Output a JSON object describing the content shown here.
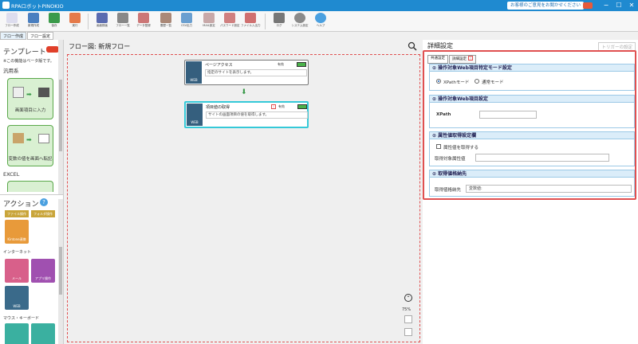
{
  "window": {
    "title": "RPAロボットPINOKIO",
    "inquiry": "お客様のご意見をお聞かせください",
    "min_label": "−",
    "max_label": "☐",
    "close_label": "✕"
  },
  "toolbar": {
    "buttons": [
      {
        "label": "フロー作成"
      },
      {
        "label": "新規作成"
      },
      {
        "label": "保存"
      },
      {
        "label": "実行"
      },
      {
        "label": "画面録画"
      },
      {
        "label": "フロー一覧"
      },
      {
        "label": "データ登録"
      },
      {
        "label": "履歴一覧"
      },
      {
        "label": "CSV出力"
      },
      {
        "label": "MAIL設定"
      },
      {
        "label": "パスワード設定"
      },
      {
        "label": "ファイル入出力"
      },
      {
        "label": "ログ"
      },
      {
        "label": "システム設定"
      },
      {
        "label": "ヘルプ"
      }
    ]
  },
  "subtabs": {
    "flow": "フロー作成",
    "settings": "フロー設定"
  },
  "left": {
    "template_title": "テンプレート",
    "beta_note": "※この機能はベータ版です。",
    "general": "汎用系",
    "cards": [
      {
        "label": "画面項目に入力"
      },
      {
        "label": "変数の値を画面へ転記"
      }
    ],
    "excel": "EXCEL",
    "action_title": "アクション",
    "file_ops": "ファイル操作",
    "folder_ops": "フォルダ操作",
    "kintone": "Kintone連携",
    "internet": "インターネット",
    "mail": "メール",
    "app_ops": "アプリ操作",
    "web": "WEB",
    "mouse_kb": "マウス・キーボード"
  },
  "center": {
    "title": "フロー図: 新規フロー",
    "zoom": "75%",
    "nodes": [
      {
        "title": "ページアクセス",
        "desc": "指定のサイトを表示します。",
        "state": "有効",
        "icon": "WEB"
      },
      {
        "title": "項目値の取得",
        "desc": "サイトの画面項目の値を取得します。",
        "state": "有効",
        "icon": "WEB"
      }
    ]
  },
  "right": {
    "title": "詳細設定",
    "trigger": "トリガーの設定",
    "tab_common": "共通設定",
    "tab_detail": "詳細設定",
    "sec1": {
      "title": "操作対象Web項目特定モード設定",
      "opt1": "XPathモード",
      "opt2": "通常モード"
    },
    "sec2": {
      "title": "操作対象Web項目設定",
      "xpath_label": "XPath",
      "xpath_value": ""
    },
    "sec3": {
      "title": "属性値取得設定欄",
      "check_label": "属性値を取得する",
      "attr_label": "取得対象属性値",
      "attr_value": ""
    },
    "sec4": {
      "title": "取得値格納先",
      "dest_label": "取得値格納先",
      "dest_value": "変数値:"
    }
  },
  "colors": {
    "accent": "#1f8ad0",
    "highlight": "#e05050",
    "selected_node": "#35c9d8"
  }
}
